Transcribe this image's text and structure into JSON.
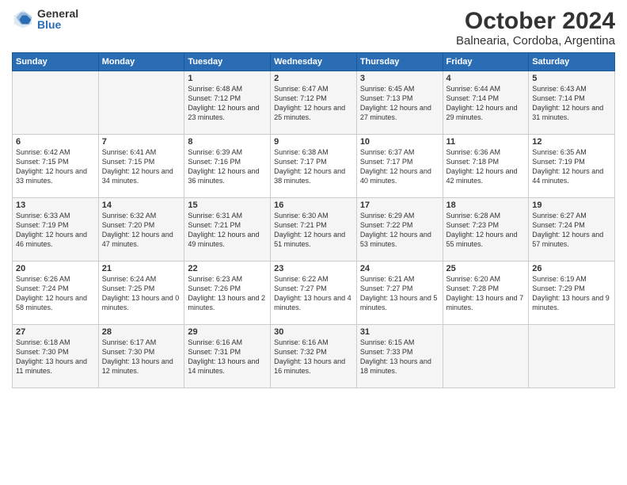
{
  "logo": {
    "general": "General",
    "blue": "Blue"
  },
  "title": "October 2024",
  "subtitle": "Balnearia, Cordoba, Argentina",
  "days_of_week": [
    "Sunday",
    "Monday",
    "Tuesday",
    "Wednesday",
    "Thursday",
    "Friday",
    "Saturday"
  ],
  "weeks": [
    [
      {
        "day": "",
        "info": ""
      },
      {
        "day": "",
        "info": ""
      },
      {
        "day": "1",
        "info": "Sunrise: 6:48 AM\nSunset: 7:12 PM\nDaylight: 12 hours and 23 minutes."
      },
      {
        "day": "2",
        "info": "Sunrise: 6:47 AM\nSunset: 7:12 PM\nDaylight: 12 hours and 25 minutes."
      },
      {
        "day": "3",
        "info": "Sunrise: 6:45 AM\nSunset: 7:13 PM\nDaylight: 12 hours and 27 minutes."
      },
      {
        "day": "4",
        "info": "Sunrise: 6:44 AM\nSunset: 7:14 PM\nDaylight: 12 hours and 29 minutes."
      },
      {
        "day": "5",
        "info": "Sunrise: 6:43 AM\nSunset: 7:14 PM\nDaylight: 12 hours and 31 minutes."
      }
    ],
    [
      {
        "day": "6",
        "info": "Sunrise: 6:42 AM\nSunset: 7:15 PM\nDaylight: 12 hours and 33 minutes."
      },
      {
        "day": "7",
        "info": "Sunrise: 6:41 AM\nSunset: 7:15 PM\nDaylight: 12 hours and 34 minutes."
      },
      {
        "day": "8",
        "info": "Sunrise: 6:39 AM\nSunset: 7:16 PM\nDaylight: 12 hours and 36 minutes."
      },
      {
        "day": "9",
        "info": "Sunrise: 6:38 AM\nSunset: 7:17 PM\nDaylight: 12 hours and 38 minutes."
      },
      {
        "day": "10",
        "info": "Sunrise: 6:37 AM\nSunset: 7:17 PM\nDaylight: 12 hours and 40 minutes."
      },
      {
        "day": "11",
        "info": "Sunrise: 6:36 AM\nSunset: 7:18 PM\nDaylight: 12 hours and 42 minutes."
      },
      {
        "day": "12",
        "info": "Sunrise: 6:35 AM\nSunset: 7:19 PM\nDaylight: 12 hours and 44 minutes."
      }
    ],
    [
      {
        "day": "13",
        "info": "Sunrise: 6:33 AM\nSunset: 7:19 PM\nDaylight: 12 hours and 46 minutes."
      },
      {
        "day": "14",
        "info": "Sunrise: 6:32 AM\nSunset: 7:20 PM\nDaylight: 12 hours and 47 minutes."
      },
      {
        "day": "15",
        "info": "Sunrise: 6:31 AM\nSunset: 7:21 PM\nDaylight: 12 hours and 49 minutes."
      },
      {
        "day": "16",
        "info": "Sunrise: 6:30 AM\nSunset: 7:21 PM\nDaylight: 12 hours and 51 minutes."
      },
      {
        "day": "17",
        "info": "Sunrise: 6:29 AM\nSunset: 7:22 PM\nDaylight: 12 hours and 53 minutes."
      },
      {
        "day": "18",
        "info": "Sunrise: 6:28 AM\nSunset: 7:23 PM\nDaylight: 12 hours and 55 minutes."
      },
      {
        "day": "19",
        "info": "Sunrise: 6:27 AM\nSunset: 7:24 PM\nDaylight: 12 hours and 57 minutes."
      }
    ],
    [
      {
        "day": "20",
        "info": "Sunrise: 6:26 AM\nSunset: 7:24 PM\nDaylight: 12 hours and 58 minutes."
      },
      {
        "day": "21",
        "info": "Sunrise: 6:24 AM\nSunset: 7:25 PM\nDaylight: 13 hours and 0 minutes."
      },
      {
        "day": "22",
        "info": "Sunrise: 6:23 AM\nSunset: 7:26 PM\nDaylight: 13 hours and 2 minutes."
      },
      {
        "day": "23",
        "info": "Sunrise: 6:22 AM\nSunset: 7:27 PM\nDaylight: 13 hours and 4 minutes."
      },
      {
        "day": "24",
        "info": "Sunrise: 6:21 AM\nSunset: 7:27 PM\nDaylight: 13 hours and 5 minutes."
      },
      {
        "day": "25",
        "info": "Sunrise: 6:20 AM\nSunset: 7:28 PM\nDaylight: 13 hours and 7 minutes."
      },
      {
        "day": "26",
        "info": "Sunrise: 6:19 AM\nSunset: 7:29 PM\nDaylight: 13 hours and 9 minutes."
      }
    ],
    [
      {
        "day": "27",
        "info": "Sunrise: 6:18 AM\nSunset: 7:30 PM\nDaylight: 13 hours and 11 minutes."
      },
      {
        "day": "28",
        "info": "Sunrise: 6:17 AM\nSunset: 7:30 PM\nDaylight: 13 hours and 12 minutes."
      },
      {
        "day": "29",
        "info": "Sunrise: 6:16 AM\nSunset: 7:31 PM\nDaylight: 13 hours and 14 minutes."
      },
      {
        "day": "30",
        "info": "Sunrise: 6:16 AM\nSunset: 7:32 PM\nDaylight: 13 hours and 16 minutes."
      },
      {
        "day": "31",
        "info": "Sunrise: 6:15 AM\nSunset: 7:33 PM\nDaylight: 13 hours and 18 minutes."
      },
      {
        "day": "",
        "info": ""
      },
      {
        "day": "",
        "info": ""
      }
    ]
  ]
}
